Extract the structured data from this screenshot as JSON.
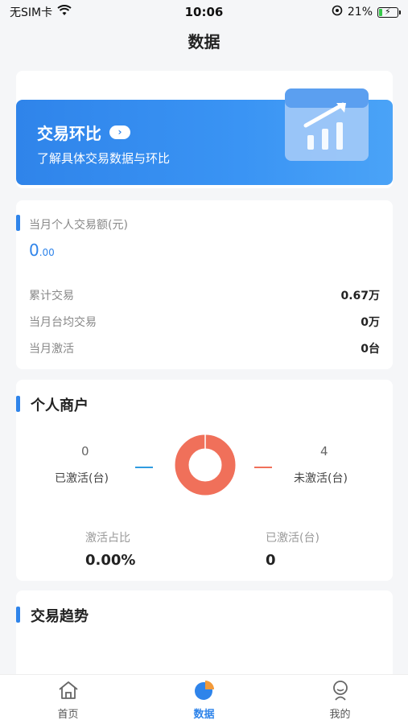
{
  "status_bar": {
    "carrier": "无SIM卡",
    "time": "10:06",
    "battery": "21%",
    "battery_level": 0.21
  },
  "nav": {
    "title": "数据"
  },
  "banner": {
    "title": "交易环比",
    "subtitle": "了解具体交易数据与环比"
  },
  "personal_stats": {
    "label": "当月个人交易额(元)",
    "value_int": "0",
    "value_dec": ".00",
    "rows": [
      {
        "label": "累计交易",
        "value": "0.67万"
      },
      {
        "label": "当月台均交易",
        "value": "0万"
      },
      {
        "label": "当月激活",
        "value": "0台"
      }
    ]
  },
  "merchant": {
    "title": "个人商户",
    "activated_count": "0",
    "activated_label": "已激活(台)",
    "inactive_count": "4",
    "inactive_label": "未激活(台)",
    "ratio_label": "激活占比",
    "ratio_value": "0.00%",
    "activated2_label": "已激活(台)",
    "activated2_value": "0",
    "colors": {
      "activated": "#2f9be0",
      "inactive": "#f0705a"
    },
    "donut_fraction_activated": 0
  },
  "trend": {
    "title": "交易趋势"
  },
  "tabbar": {
    "tabs": [
      {
        "label": "首页",
        "icon": "home-icon"
      },
      {
        "label": "数据",
        "icon": "pie-chart-icon"
      },
      {
        "label": "我的",
        "icon": "user-icon"
      }
    ],
    "active_index": 1
  }
}
